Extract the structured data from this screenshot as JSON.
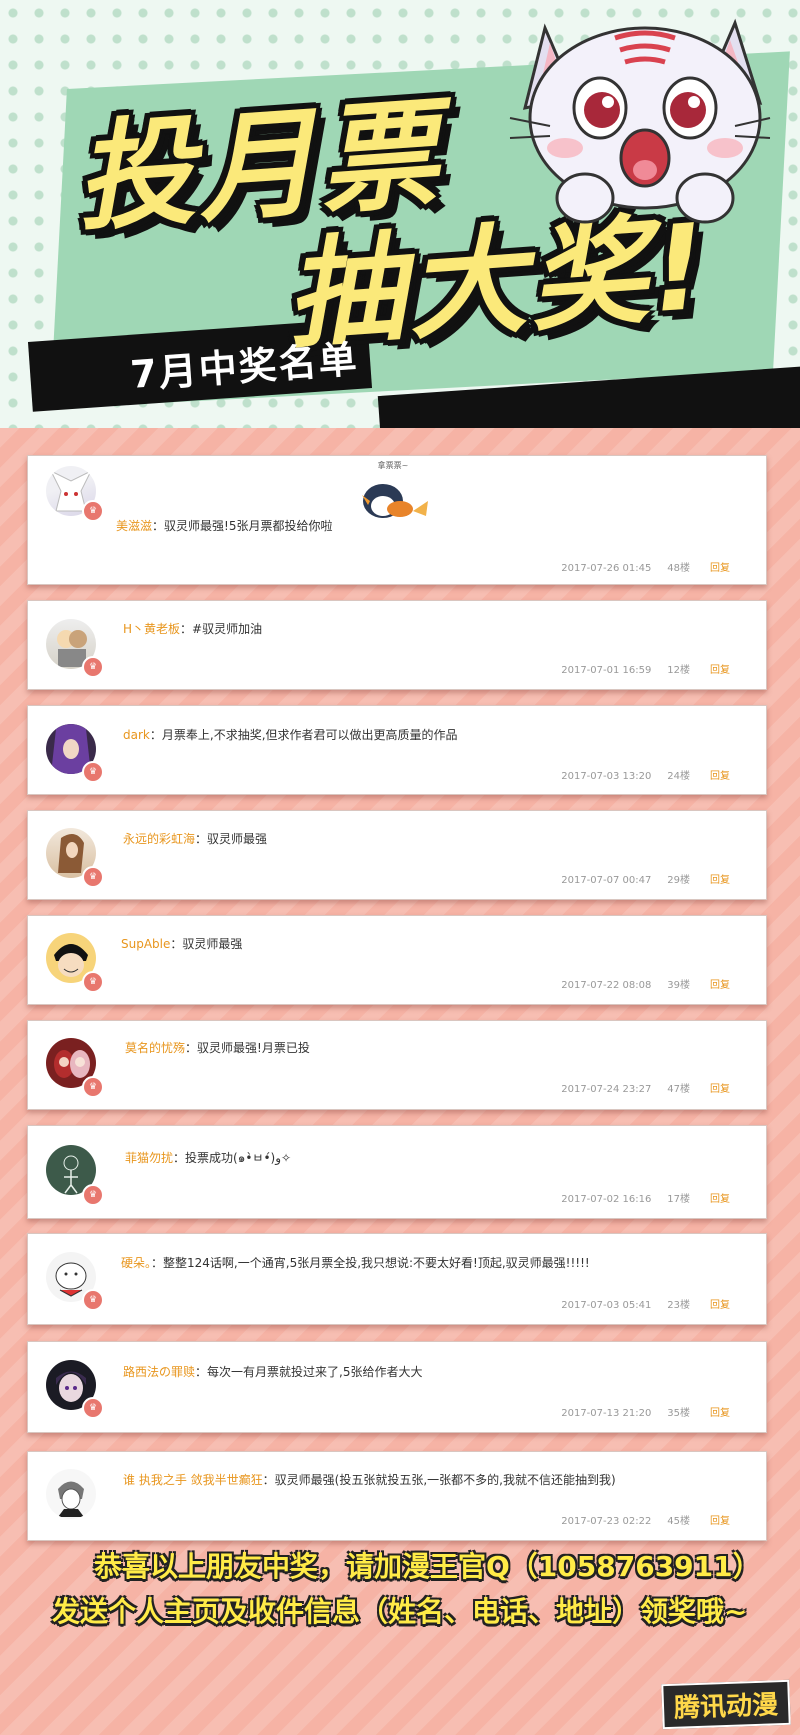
{
  "header": {
    "title_line1": "投月票",
    "title_line2": "抽大奖!",
    "subtitle": "7月中奖名单"
  },
  "comments": [
    {
      "user": "美滋滋",
      "sep": "：",
      "text": "驭灵师最强!5张月票都投给你啦",
      "date": "2017-07-26 01:45",
      "floor": "48楼",
      "reply": "回复",
      "sticker_label": "拿票票~"
    },
    {
      "user": "H丶黄老板",
      "sep": "：",
      "text": "#驭灵师加油",
      "date": "2017-07-01 16:59",
      "floor": "12楼",
      "reply": "回复"
    },
    {
      "user": "dark",
      "sep": "：",
      "text": "月票奉上,不求抽奖,但求作者君可以做出更高质量的作品",
      "date": "2017-07-03 13:20",
      "floor": "24楼",
      "reply": "回复"
    },
    {
      "user": "永远的彩虹海",
      "sep": "：",
      "text": "驭灵师最强",
      "date": "2017-07-07 00:47",
      "floor": "29楼",
      "reply": "回复"
    },
    {
      "user": "SupAble",
      "sep": "：",
      "text": "驭灵师最强",
      "date": "2017-07-22 08:08",
      "floor": "39楼",
      "reply": "回复"
    },
    {
      "user": "莫名的忧殇",
      "sep": "：",
      "text": "驭灵师最强!月票已投",
      "date": "2017-07-24 23:27",
      "floor": "47楼",
      "reply": "回复"
    },
    {
      "user": "菲猫勿扰",
      "sep": "：",
      "text": "投票成功(๑•̀ㅂ•́)و✧",
      "date": "2017-07-02 16:16",
      "floor": "17楼",
      "reply": "回复"
    },
    {
      "user": "硬朵。",
      "sep": "：",
      "text": "整整124话啊,一个通宵,5张月票全投,我只想说:不要太好看!顶起,驭灵师最强!!!!!",
      "date": "2017-07-03 05:41",
      "floor": "23楼",
      "reply": "回复"
    },
    {
      "user": "路西法の罪赎",
      "sep": "：",
      "text": "每次一有月票就投过来了,5张给作者大大",
      "date": "2017-07-13 21:20",
      "floor": "35楼",
      "reply": "回复"
    },
    {
      "user": "谁 执我之手  敛我半世癫狂",
      "sep": "：",
      "text": "驭灵师最强(投五张就投五张,一张都不多的,我就不信还能抽到我)",
      "date": "2017-07-23 02:22",
      "floor": "45楼",
      "reply": "回复"
    }
  ],
  "footer": {
    "line1": "恭喜以上朋友中奖，请加漫王官Q（1058763911）",
    "line2": "发送个人主页及收件信息（姓名、电话、地址）领奖哦~",
    "logo": "腾讯动漫"
  },
  "colors": {
    "accent_username": "#e8961e",
    "board_pink": "#f6b3a5",
    "title_yellow": "#fbe97a",
    "footer_yellow": "#ffeb47"
  }
}
